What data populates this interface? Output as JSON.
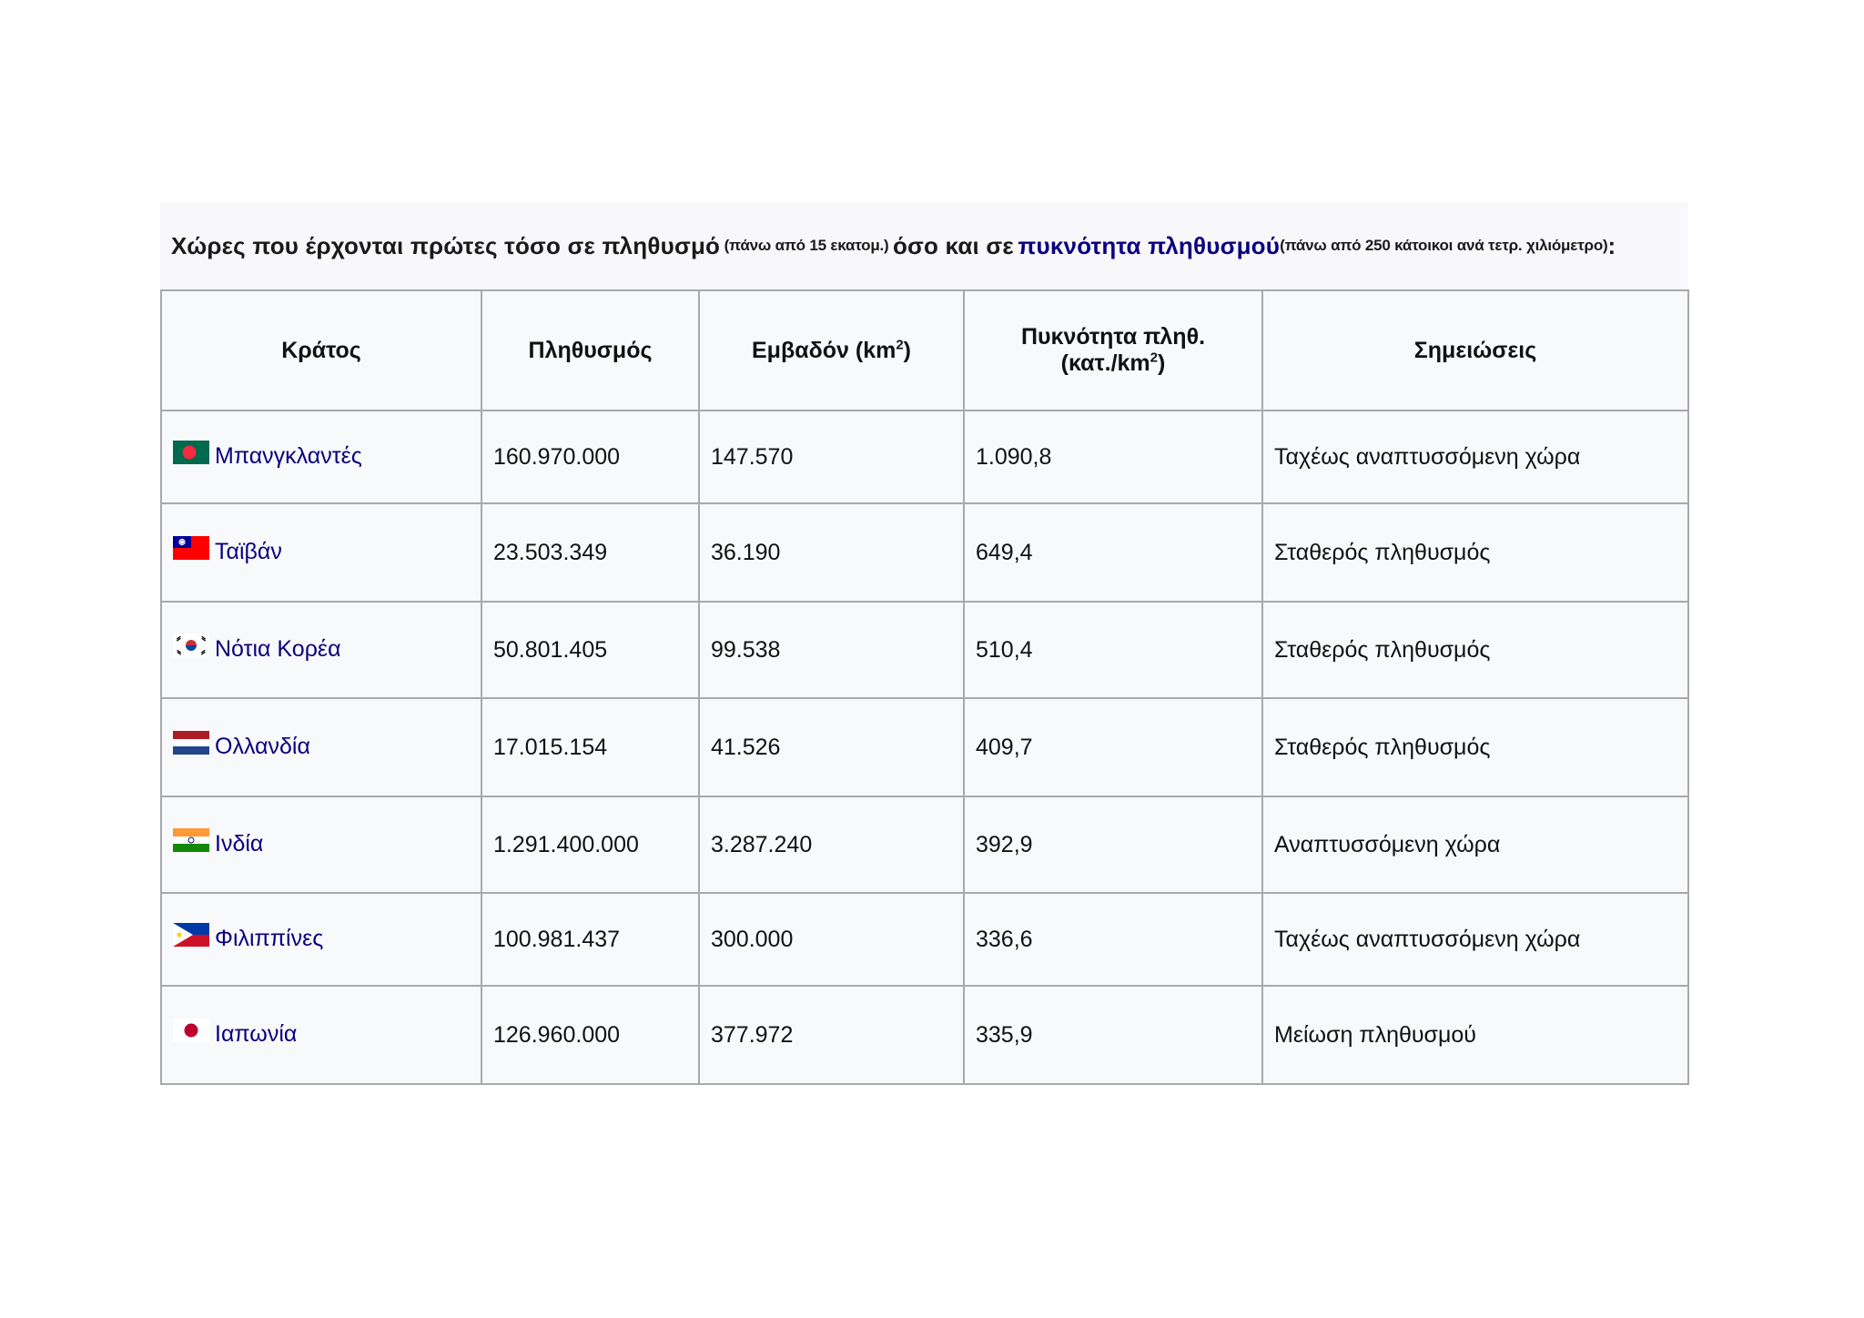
{
  "caption": {
    "part1": "Χώρες που έρχονται πρώτες τόσο σε πληθυσμό",
    "note1": "(πάνω από 15 εκατομ.)",
    "part2": "όσο και σε",
    "link": "πυκνότητα πληθυσμού",
    "note2": "(πάνω από 250 κάτοικοι ανά τετρ. χιλιόμετρο)",
    "end": ":"
  },
  "table": {
    "headers": {
      "country": "Κράτος",
      "population": "Πληθυσμός",
      "area": "Εμβαδόν (km",
      "area_sup": "2",
      "area_end": ")",
      "density_line1": "Πυκνότητα πληθ.",
      "density_line2": "(κατ./km",
      "density_sup": "2",
      "density_end": ")",
      "notes": "Σημειώσεις"
    },
    "rows": [
      {
        "country": "Μπανγκλαντές",
        "flag": "bangladesh-flag-icon",
        "population": "160.970.000",
        "area": "147.570",
        "density": "1.090,8",
        "notes": "Ταχέως αναπτυσσόμενη χώρα"
      },
      {
        "country": "Ταϊβάν",
        "flag": "taiwan-flag-icon",
        "population": "23.503.349",
        "area": "36.190",
        "density": "649,4",
        "notes": "Σταθερός πληθυσμός"
      },
      {
        "country": "Νότια Κορέα",
        "flag": "south-korea-flag-icon",
        "population": "50.801.405",
        "area": "99.538",
        "density": "510,4",
        "notes": "Σταθερός πληθυσμός"
      },
      {
        "country": "Ολλανδία",
        "flag": "netherlands-flag-icon",
        "population": "17.015.154",
        "area": "41.526",
        "density": "409,7",
        "notes": "Σταθερός πληθυσμός"
      },
      {
        "country": "Ινδία",
        "flag": "india-flag-icon",
        "population": "1.291.400.000",
        "area": "3.287.240",
        "density": "392,9",
        "notes": "Αναπτυσσόμενη χώρα"
      },
      {
        "country": "Φιλιππίνες",
        "flag": "philippines-flag-icon",
        "population": "100.981.437",
        "area": "300.000",
        "density": "336,6",
        "notes": "Ταχέως αναπτυσσόμενη χώρα"
      },
      {
        "country": "Ιαπωνία",
        "flag": "japan-flag-icon",
        "population": "126.960.000",
        "area": "377.972",
        "density": "335,9",
        "notes": "Μείωση πληθυσμού"
      }
    ]
  },
  "colors": {
    "link": "#0b0080",
    "border": "#a8a8ad",
    "table_bg": "#f8f9fa"
  }
}
